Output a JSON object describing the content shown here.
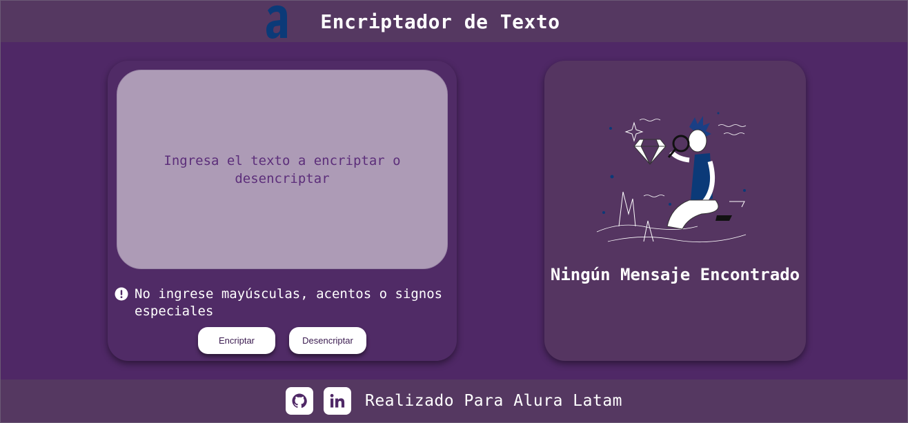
{
  "header": {
    "logo_icon": "alura-logo-icon",
    "title": "Encriptador de Texto"
  },
  "input": {
    "placeholder": "Ingresa el texto a encriptar o desencriptar",
    "value": ""
  },
  "warning": {
    "icon": "exclamation-circle-icon",
    "text": "No ingrese mayúsculas, acentos o signos especiales"
  },
  "buttons": {
    "encrypt_label": "Encriptar",
    "decrypt_label": "Desencriptar"
  },
  "output": {
    "illustration": "person-with-magnifying-glass-illustration",
    "message": "Ningún Mensaje Encontrado"
  },
  "footer": {
    "github_icon": "github-icon",
    "linkedin_icon": "linkedin-icon",
    "text": "Realizado Para Alura Latam"
  },
  "colors": {
    "background": "#4f2866",
    "header_footer": "#553861",
    "textarea": "#ad9bb6",
    "placeholder_text": "#5c2e7a",
    "logo": "#0b3a78"
  }
}
